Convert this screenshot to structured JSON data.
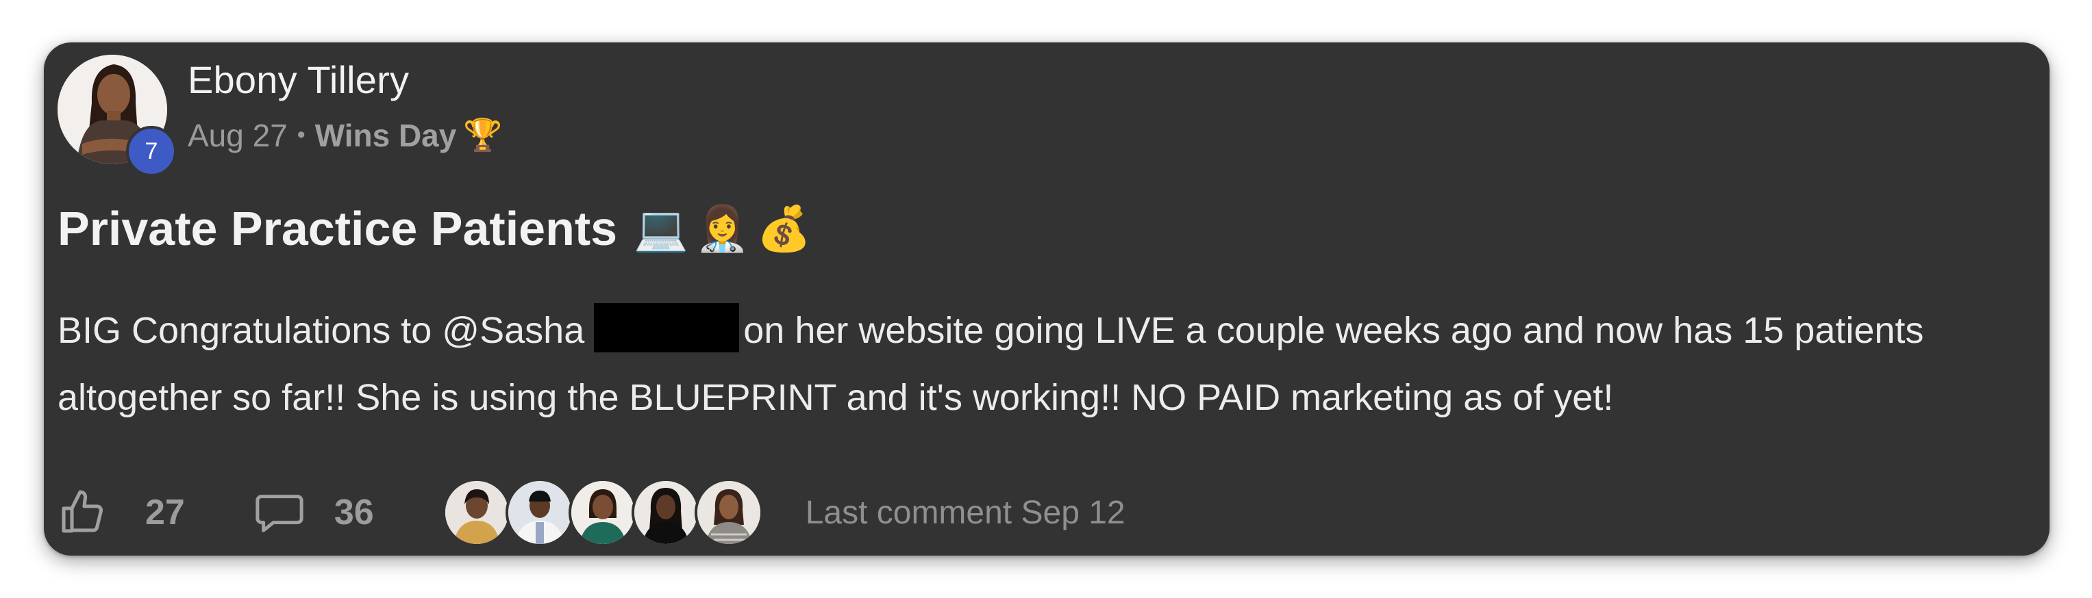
{
  "post": {
    "author": "Ebony Tillery",
    "author_level": "7",
    "date": "Aug 27",
    "separator": "•",
    "category": "Wins Day",
    "category_emoji": "🏆",
    "title": "Private Practice Patients",
    "title_emojis": [
      "💻",
      "👩‍⚕️",
      "💰"
    ],
    "body_part1": "BIG Congratulations to @Sasha",
    "body_part2": "on her website going LIVE a couple weeks ago and now has 15 patients altogether so far!! She is using the BLUEPRINT and it's working!! NO PAID marketing as of yet!"
  },
  "footer": {
    "like_count": "27",
    "comment_count": "36",
    "last_comment": "Last comment Sep 12"
  },
  "icons": {
    "like": "thumbs-up-icon",
    "comment": "comment-bubble-icon"
  },
  "colors": {
    "card_bg": "#333333",
    "level_badge": "#3e5bc5",
    "muted_text": "#9a9a9a",
    "primary_text": "#ececec"
  }
}
